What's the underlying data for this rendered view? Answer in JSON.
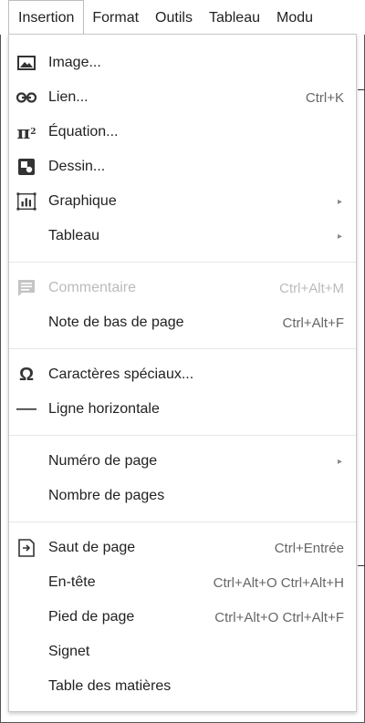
{
  "menubar": {
    "items": [
      "Insertion",
      "Format",
      "Outils",
      "Tableau",
      "Modu"
    ]
  },
  "menu": {
    "items": [
      {
        "label": "Image...",
        "icon": "image-icon"
      },
      {
        "label": "Lien...",
        "shortcut": "Ctrl+K",
        "icon": "link-icon"
      },
      {
        "label": "Équation...",
        "icon": "pi-squared-icon"
      },
      {
        "label": "Dessin...",
        "icon": "drawing-icon"
      },
      {
        "label": "Graphique",
        "icon": "chart-icon",
        "submenu": true
      },
      {
        "label": "Tableau",
        "submenu": true
      },
      {
        "label": "Commentaire",
        "shortcut": "Ctrl+Alt+M",
        "icon": "comment-icon",
        "disabled": true
      },
      {
        "label": "Note de bas de page",
        "shortcut": "Ctrl+Alt+F"
      },
      {
        "label": "Caractères spéciaux...",
        "icon": "omega-icon"
      },
      {
        "label": "Ligne horizontale",
        "icon": "horizontal-line-icon"
      },
      {
        "label": "Numéro de page",
        "submenu": true
      },
      {
        "label": "Nombre de pages"
      },
      {
        "label": "Saut de page",
        "shortcut": "Ctrl+Entrée",
        "icon": "page-break-icon"
      },
      {
        "label": "En-tête",
        "shortcut": "Ctrl+Alt+O Ctrl+Alt+H"
      },
      {
        "label": "Pied de page",
        "shortcut": "Ctrl+Alt+O Ctrl+Alt+F"
      },
      {
        "label": "Signet"
      },
      {
        "label": "Table des matières"
      }
    ],
    "submenu_arrow": "▸"
  }
}
